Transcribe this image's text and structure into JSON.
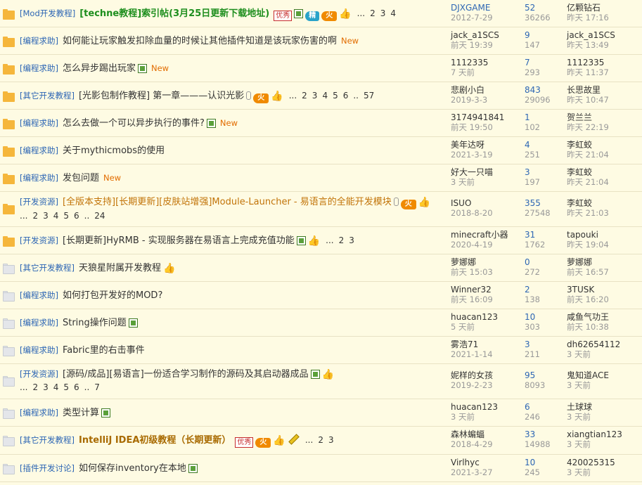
{
  "rows": [
    {
      "icon": "hot",
      "cat": "[Mod开发教程]",
      "title": "[techne教程]索引帖(3月25日更新下载地址)",
      "style": "green",
      "you": true,
      "img": true,
      "jing": true,
      "hot": true,
      "thumb": true,
      "pages": [
        "...",
        "2",
        "3",
        "4"
      ],
      "author": "DJXGAME",
      "date": "2012-7-29",
      "replies": "52",
      "views": "36266",
      "last_user": "亿颗钻石",
      "last_time": "昨天 17:16",
      "h": 39,
      "two": false,
      "author_link": true
    },
    {
      "icon": "hot",
      "cat": "[编程求助]",
      "title": "如何能让玩家触发扣除血量的时候让其他插件知道是该玩家伤害的啊",
      "style": "",
      "newtag": "New",
      "author": "jack_a1SCS",
      "date": "前天 19:39",
      "replies": "9",
      "views": "147",
      "last_user": "jack_a1SCS",
      "last_time": "昨天 13:49",
      "h": 39
    },
    {
      "icon": "hot",
      "cat": "[编程求助]",
      "title": "怎么异步踢出玩家",
      "style": "",
      "img": true,
      "newtag": "New",
      "author": "1112335",
      "date": "7 天前",
      "replies": "7",
      "views": "293",
      "last_user": "1112335",
      "last_time": "昨天 11:37",
      "h": 39
    },
    {
      "icon": "hot",
      "cat": "[其它开发教程]",
      "title": "[光影包制作教程] 第一章———认识光影",
      "style": "",
      "clip": true,
      "hot": true,
      "thumb": true,
      "pages": [
        "...",
        "2",
        "3",
        "4",
        "5",
        "6",
        "..",
        "57"
      ],
      "author": "悲剧小白",
      "date": "2019-3-3",
      "replies": "843",
      "views": "29096",
      "last_user": "长思故里",
      "last_time": "昨天 10:47",
      "h": 39
    },
    {
      "icon": "hot",
      "cat": "[编程求助]",
      "title": "怎么去做一个可以异步执行的事件?",
      "style": "",
      "img": true,
      "newtag": "New",
      "author": "3174941841",
      "date": "前天 19:50",
      "replies": "1",
      "views": "102",
      "last_user": "贺兰兰",
      "last_time": "昨天 22:19",
      "h": 39
    },
    {
      "icon": "hot",
      "cat": "[编程求助]",
      "title": "关于mythicmobs的使用",
      "style": "",
      "author": "美年达呀",
      "date": "2021-3-19",
      "replies": "4",
      "views": "251",
      "last_user": "李虹蛟",
      "last_time": "昨天 21:04",
      "h": 39
    },
    {
      "icon": "hot",
      "cat": "[编程求助]",
      "title": "发包问题",
      "style": "",
      "newtag": "New",
      "author": "好大一只喵",
      "date": "3 天前",
      "replies": "3",
      "views": "197",
      "last_user": "李虹蛟",
      "last_time": "昨天 21:04",
      "h": 39
    },
    {
      "icon": "hot",
      "cat": "[开发资源]",
      "title": "[全版本支持][长期更新][皮肤站增强]Module-Launcher - 易语言的全能开发模块",
      "style": "orange",
      "clip": true,
      "hot": true,
      "thumb": true,
      "pages": [
        "...",
        "2",
        "3",
        "4",
        "5",
        "6",
        "..",
        "24"
      ],
      "two": true,
      "author": "ISUO",
      "date": "2018-8-20",
      "replies": "355",
      "views": "27548",
      "last_user": "李虹蛟",
      "last_time": "昨天 21:03",
      "h": 50
    },
    {
      "icon": "hot",
      "cat": "[开发资源]",
      "title": "[长期更新]HyRMB - 实现服务器在易语言上完成充值功能",
      "style": "",
      "img": true,
      "thumb": true,
      "pages": [
        "...",
        "2",
        "3"
      ],
      "author": "minecraft小器",
      "date": "2020-4-19",
      "replies": "31",
      "views": "1762",
      "last_user": "tapouki",
      "last_time": "昨天 19:04",
      "h": 39
    },
    {
      "icon": "cold",
      "cat": "[其它开发教程]",
      "title": "天狼星附属开发教程",
      "style": "",
      "thumb": true,
      "author": "萝娜娜",
      "date": "前天 15:03",
      "replies": "0",
      "views": "272",
      "last_user": "萝娜娜",
      "last_time": "前天 16:57",
      "h": 39
    },
    {
      "icon": "cold",
      "cat": "[编程求助]",
      "title": "如何打包开发好的MOD?",
      "style": "",
      "author": "Winner32",
      "date": "前天 16:09",
      "replies": "2",
      "views": "138",
      "last_user": "3TUSK",
      "last_time": "前天 16:20",
      "h": 39
    },
    {
      "icon": "cold",
      "cat": "[编程求助]",
      "title": "String操作问题",
      "style": "",
      "img": true,
      "author": "huacan123",
      "date": "5 天前",
      "replies": "10",
      "views": "303",
      "last_user": "咸鱼气功王",
      "last_time": "前天 10:38",
      "h": 39
    },
    {
      "icon": "cold",
      "cat": "[编程求助]",
      "title": "Fabric里的右击事件",
      "style": "",
      "author": "雾浩71",
      "date": "2021-1-14",
      "replies": "3",
      "views": "211",
      "last_user": "dh62654112",
      "last_time": "3 天前",
      "h": 39
    },
    {
      "icon": "cold",
      "cat": "[开发资源]",
      "title": "[源码/成品][易语言]一份适合学习制作的源码及其启动器成品",
      "style": "",
      "img": true,
      "thumb": true,
      "pages": [
        "...",
        "2",
        "3",
        "4",
        "5",
        "6",
        "..",
        "7"
      ],
      "two": true,
      "author": "妮样的女孩",
      "date": "2019-2-23",
      "replies": "95",
      "views": "8093",
      "last_user": "鬼知道ACE",
      "last_time": "3 天前",
      "h": 50
    },
    {
      "icon": "cold",
      "cat": "[编程求助]",
      "title": "类型计算",
      "style": "",
      "img": true,
      "author": "huacan123",
      "date": "3 天前",
      "replies": "6",
      "views": "246",
      "last_user": "土球球",
      "last_time": "3 天前",
      "h": 39
    },
    {
      "icon": "cold",
      "cat": "[其它开发教程]",
      "title": "IntelliJ IDEA初级教程（长期更新）",
      "style": "brown",
      "you": true,
      "hot": true,
      "thumb": true,
      "pages": [
        "...",
        "2",
        "3"
      ],
      "author": "森林蝙蝠",
      "date": "2018-4-29",
      "replies": "33",
      "views": "14988",
      "last_user": "xiangtian123",
      "last_time": "3 天前",
      "h": 40,
      "pencil": true
    },
    {
      "icon": "cold",
      "cat": "[插件开发讨论]",
      "title": "如何保存inventory在本地",
      "style": "",
      "img": true,
      "author": "Virlhyc",
      "date": "2021-3-27",
      "replies": "10",
      "views": "245",
      "last_user": "420025315",
      "last_time": "3 天前",
      "h": 39
    }
  ],
  "badges": {
    "you": "优秀",
    "jing": "精",
    "hot": "火"
  },
  "icons": {
    "hot_folder": "folder-hot-icon",
    "cold_folder": "folder-cold-icon",
    "image": "image-attachment-icon",
    "clip": "paperclip-icon",
    "thumb": "thumbs-up-icon",
    "pencil": "pencil-icon"
  }
}
